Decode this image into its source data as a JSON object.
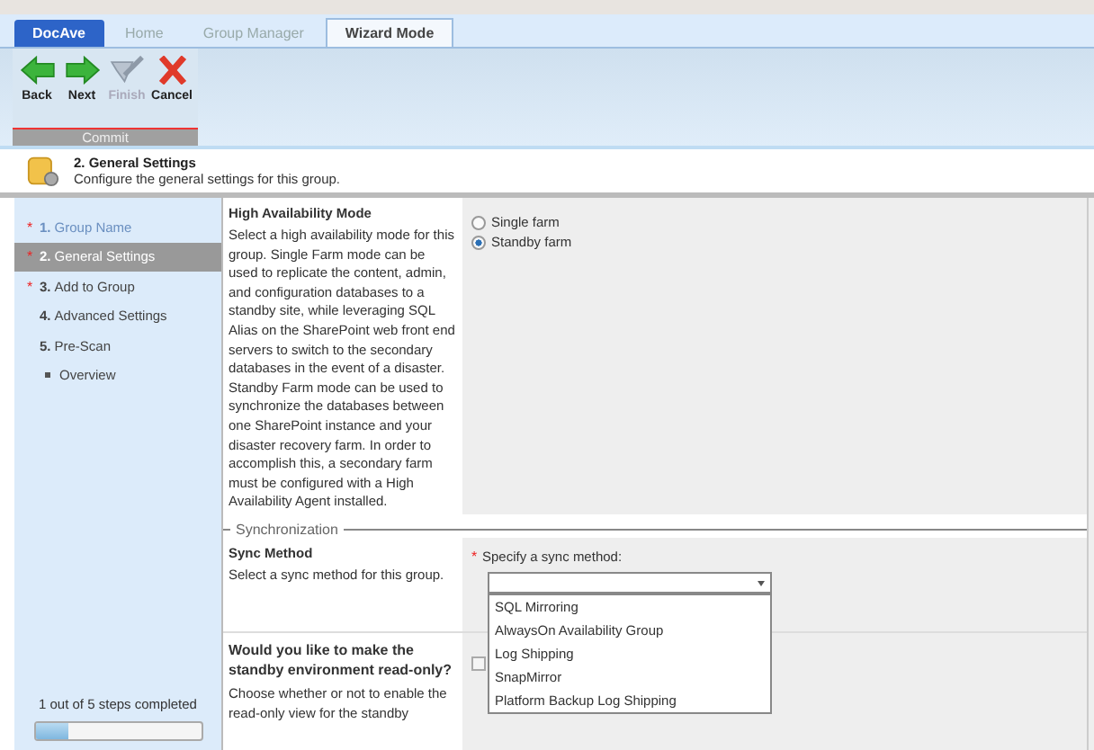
{
  "tabs": [
    {
      "label": "DocAve",
      "kind": "brand",
      "selected": false
    },
    {
      "label": "Home",
      "kind": "tab",
      "selected": false
    },
    {
      "label": "Group Manager",
      "kind": "tab",
      "selected": false
    },
    {
      "label": "Wizard Mode",
      "kind": "tab",
      "selected": true
    }
  ],
  "ribbon": {
    "buttons": [
      {
        "label": "Back",
        "kind": "back",
        "disabled": false
      },
      {
        "label": "Next",
        "kind": "next",
        "disabled": false
      },
      {
        "label": "Finish",
        "kind": "finish",
        "disabled": true
      },
      {
        "label": "Cancel",
        "kind": "cancel",
        "disabled": false
      }
    ],
    "group": "Commit"
  },
  "header": {
    "title": "2. General Settings",
    "subtitle": "Configure the general settings for this group."
  },
  "steps": [
    {
      "marker": "*",
      "number": "1.",
      "label": "Group Name",
      "selected": false,
      "done": true
    },
    {
      "marker": "*",
      "number": "2.",
      "label": "General Settings",
      "selected": true,
      "done": false
    },
    {
      "marker": "*",
      "number": "3.",
      "label": "Add to Group",
      "selected": false,
      "done": false
    },
    {
      "number": "4.",
      "label": "Advanced Settings",
      "selected": false,
      "done": false
    },
    {
      "number": "5.",
      "label": "Pre-Scan",
      "selected": false,
      "done": false
    },
    {
      "label": "Overview",
      "selected": false,
      "done": false
    }
  ],
  "progress": {
    "text": "1 out of 5 steps completed",
    "level": 0.2
  },
  "ha_mode": {
    "title": "High Availability Mode",
    "description": "Select a high availability mode for this group. Single Farm mode can be used to replicate the content, admin, and configuration databases to a standby site, while leveraging SQL Alias on the SharePoint web front end servers to switch to the secondary databases in the event of a disaster. Standby Farm mode can be used to synchronize the databases between one SharePoint instance and your disaster recovery farm. In order to accomplish this, a secondary farm must be configured with a High Availability Agent installed.",
    "options": [
      {
        "label": "Single farm",
        "selected": false
      },
      {
        "label": "Standby farm",
        "selected": true
      }
    ]
  },
  "sync": {
    "section": "Synchronization",
    "title": "Sync Method",
    "description": "Select a sync method for this group.",
    "field_label": "Specify a sync method:",
    "required_marker": "*",
    "options": [
      "SQL Mirroring",
      "AlwaysOn Availability Group",
      "Log Shipping",
      "SnapMirror",
      "Platform Backup Log Shipping"
    ]
  },
  "read_only": {
    "title": "Would you like to make the standby environment read-only?",
    "description": "Choose whether or not to enable the read-only view for the standby",
    "checked": false
  }
}
